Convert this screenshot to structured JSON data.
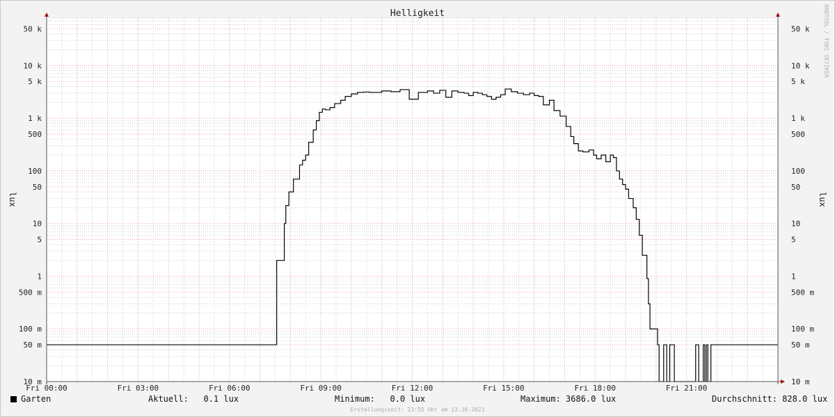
{
  "watermark": "RRDTOOL / TOBI OETIKER",
  "footer": "Erstellungszeit: 23:55 Uhr am 13.10.2023",
  "legend": {
    "series_name": "Garten",
    "current": "Aktuell:   0.1 lux",
    "minimum": "Minimum:   0.0 lux",
    "maximum": "Maximum: 3686.0 lux",
    "average": "Durchschnitt: 828.0 lux"
  },
  "colors": {
    "line": "#000000",
    "minor_grid": "#cccccc",
    "major_grid": "#e8a0a0",
    "arrow": "#a01010"
  },
  "chart_data": {
    "type": "line",
    "title": "Helligkeit",
    "ylabel": "lux",
    "xlabel": "",
    "y_scale": "log",
    "ylim": [
      0.01,
      80000
    ],
    "xlim": [
      0,
      24
    ],
    "grid": true,
    "x_ticks": [
      {
        "v": 0,
        "label": "Fri 00:00"
      },
      {
        "v": 3,
        "label": "Fri 03:00"
      },
      {
        "v": 6,
        "label": "Fri 06:00"
      },
      {
        "v": 9,
        "label": "Fri 09:00"
      },
      {
        "v": 12,
        "label": "Fri 12:00"
      },
      {
        "v": 15,
        "label": "Fri 15:00"
      },
      {
        "v": 18,
        "label": "Fri 18:00"
      },
      {
        "v": 21,
        "label": "Fri 21:00"
      }
    ],
    "y_ticks": [
      {
        "v": 50000,
        "label": "50 k"
      },
      {
        "v": 10000,
        "label": "10 k"
      },
      {
        "v": 5000,
        "label": "5 k"
      },
      {
        "v": 1000,
        "label": "1 k"
      },
      {
        "v": 500,
        "label": "500"
      },
      {
        "v": 100,
        "label": "100"
      },
      {
        "v": 50,
        "label": "50"
      },
      {
        "v": 10,
        "label": "10"
      },
      {
        "v": 5,
        "label": "5"
      },
      {
        "v": 1,
        "label": "1"
      },
      {
        "v": 0.5,
        "label": "500 m"
      },
      {
        "v": 0.1,
        "label": "100 m"
      },
      {
        "v": 0.05,
        "label": "50 m"
      },
      {
        "v": 0.01,
        "label": "10 m"
      }
    ],
    "series": [
      {
        "name": "Garten",
        "x": [
          0,
          7.55,
          7.55,
          7.8,
          7.8,
          7.85,
          7.85,
          7.95,
          7.95,
          8.1,
          8.1,
          8.3,
          8.3,
          8.4,
          8.4,
          8.5,
          8.5,
          8.6,
          8.6,
          8.75,
          8.75,
          8.85,
          8.85,
          8.95,
          8.95,
          9.05,
          9.05,
          9.15,
          9.15,
          9.3,
          9.3,
          9.45,
          9.45,
          9.65,
          9.65,
          9.8,
          9.8,
          10.0,
          10.0,
          10.2,
          10.2,
          10.4,
          10.4,
          10.6,
          10.6,
          10.8,
          10.8,
          11.0,
          11.0,
          11.3,
          11.3,
          11.6,
          11.6,
          11.9,
          11.9,
          12.2,
          12.2,
          12.5,
          12.5,
          12.7,
          12.7,
          12.9,
          12.9,
          13.1,
          13.1,
          13.3,
          13.3,
          13.5,
          13.5,
          13.7,
          13.7,
          13.85,
          13.85,
          14.0,
          14.0,
          14.15,
          14.15,
          14.3,
          14.3,
          14.45,
          14.45,
          14.6,
          14.6,
          14.75,
          14.75,
          14.9,
          14.9,
          15.05,
          15.05,
          15.25,
          15.25,
          15.45,
          15.45,
          15.65,
          15.65,
          15.85,
          15.85,
          16.0,
          16.0,
          16.15,
          16.15,
          16.3,
          16.3,
          16.5,
          16.5,
          16.65,
          16.65,
          16.85,
          16.85,
          17.05,
          17.05,
          17.2,
          17.2,
          17.3,
          17.3,
          17.45,
          17.45,
          17.6,
          17.6,
          17.8,
          17.8,
          17.95,
          17.95,
          18.05,
          18.05,
          18.2,
          18.2,
          18.35,
          18.35,
          18.5,
          18.5,
          18.6,
          18.6,
          18.7,
          18.7,
          18.8,
          18.8,
          18.9,
          18.9,
          19.0,
          19.0,
          19.1,
          19.1,
          19.25,
          19.25,
          19.35,
          19.35,
          19.45,
          19.45,
          19.55,
          19.55,
          19.7,
          19.7,
          19.75,
          19.75,
          19.8,
          19.8,
          20.05,
          20.05,
          20.1,
          20.1,
          20.25,
          20.25,
          20.35,
          20.35,
          20.45,
          20.45,
          20.6,
          20.6,
          21.3,
          21.3,
          21.4,
          21.4,
          21.55,
          21.55,
          21.6,
          21.6,
          21.65,
          21.65,
          21.7,
          21.7,
          21.8,
          21.8,
          24
        ],
        "values": [
          0.05,
          0.05,
          2.0,
          2.0,
          10.0,
          10.0,
          22,
          22,
          40,
          40,
          70,
          70,
          130,
          130,
          160,
          160,
          200,
          200,
          350,
          350,
          600,
          600,
          900,
          900,
          1300,
          1300,
          1500,
          1500,
          1450,
          1450,
          1600,
          1600,
          1900,
          1900,
          2200,
          2200,
          2600,
          2600,
          2900,
          2900,
          3100,
          3100,
          3150,
          3150,
          3100,
          3100,
          3100,
          3100,
          3300,
          3300,
          3200,
          3200,
          3500,
          3500,
          2300,
          2300,
          3100,
          3100,
          3300,
          3300,
          3000,
          3000,
          3400,
          3400,
          2500,
          2500,
          3300,
          3300,
          3100,
          3100,
          3000,
          3000,
          2700,
          2700,
          3100,
          3100,
          3000,
          3000,
          2800,
          2800,
          2600,
          2600,
          2300,
          2300,
          2500,
          2500,
          2800,
          2800,
          3600,
          3600,
          3200,
          3200,
          3000,
          3000,
          2800,
          2800,
          3000,
          3000,
          2700,
          2700,
          2600,
          2600,
          1800,
          1800,
          2200,
          2200,
          1400,
          1400,
          1100,
          1100,
          700,
          700,
          450,
          450,
          330,
          330,
          240,
          240,
          230,
          230,
          250,
          250,
          200,
          200,
          170,
          170,
          200,
          200,
          150,
          150,
          200,
          200,
          180,
          180,
          100,
          100,
          70,
          70,
          55,
          55,
          45,
          45,
          30,
          30,
          20,
          20,
          12,
          12,
          6,
          6,
          2.5,
          2.5,
          0.9,
          0.9,
          0.3,
          0.3,
          0.1,
          0.1,
          0.05,
          0.05,
          0.01,
          0.01,
          0.05,
          0.05,
          0.01,
          0.01,
          0.05,
          0.05,
          0.01,
          0.01,
          0.05,
          0.05,
          0.01,
          0.01,
          0.05,
          0.05,
          0.01,
          0.01,
          0.05,
          0.05,
          0.01,
          0.01,
          0.05,
          0.05
        ]
      }
    ]
  }
}
